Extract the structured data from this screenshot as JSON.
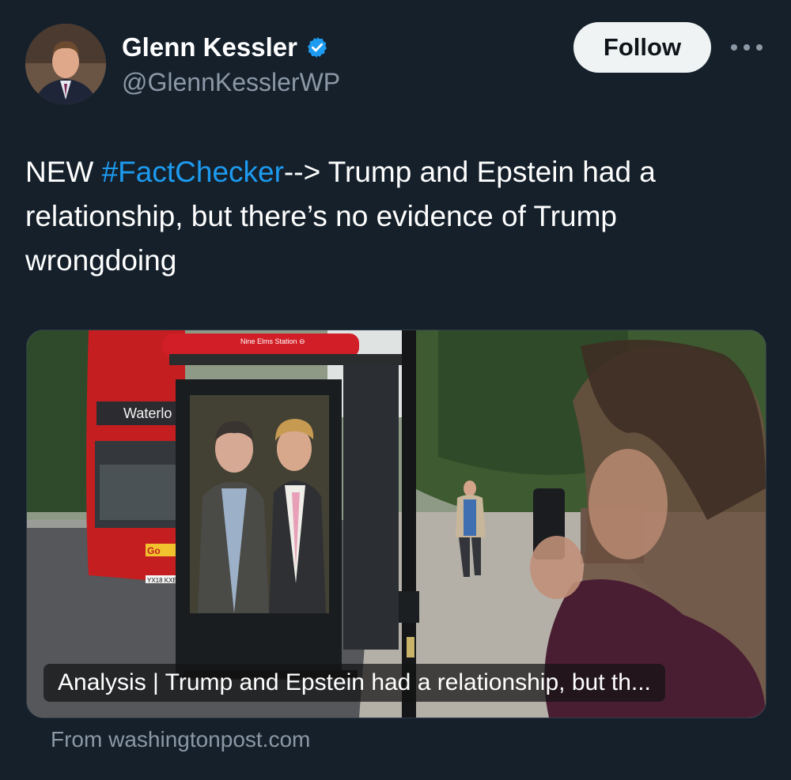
{
  "author": {
    "display_name": "Glenn Kessler",
    "handle": "@GlennKesslerWP",
    "verified_icon": "verified-badge-icon",
    "avatar_alt": "Glenn Kessler avatar"
  },
  "actions": {
    "follow_label": "Follow",
    "more_icon": "more-options-icon"
  },
  "tweet": {
    "prefix": "NEW ",
    "hashtag": "#FactChecker",
    "body": "--> Trump and Epstein had a relationship, but there’s no evidence of Trump wrongdoing"
  },
  "card": {
    "caption": "Analysis | Trump and Epstein had a relationship, but th...",
    "source": "From washingtonpost.com",
    "bus_destination": "Waterlo",
    "bus_stop_sign": "Nine Elms Station ⊖",
    "bus_plate": "YX18 KXE",
    "bus_logo": "Go"
  },
  "colors": {
    "background": "#15202b",
    "link": "#1d9bf0",
    "secondary_text": "#8b98a5",
    "follow_bg": "#eff3f4",
    "verified": "#1d9bf0"
  }
}
